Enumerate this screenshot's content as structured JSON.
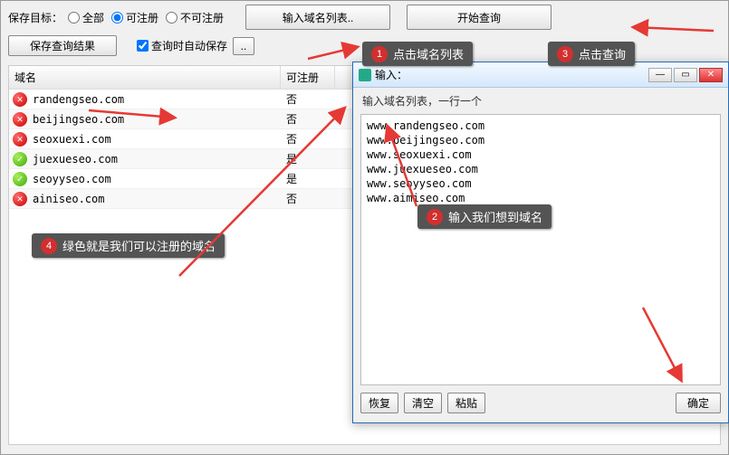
{
  "toolbar": {
    "save_target_label": "保存目标：",
    "radio_all": "全部",
    "radio_can": "可注册",
    "radio_cannot": "不可注册",
    "input_list_btn": "输入域名列表..",
    "start_query_btn": "开始查询",
    "save_results_btn": "保存查询结果",
    "auto_save_chk": "查询时自动保存",
    "dotdot_btn": ".."
  },
  "table": {
    "col_domain": "域名",
    "col_reg": "可注册",
    "rows": [
      {
        "domain": "randengseo.com",
        "reg": "否",
        "ok": false
      },
      {
        "domain": "beijingseo.com",
        "reg": "否",
        "ok": false
      },
      {
        "domain": "seoxuexi.com",
        "reg": "否",
        "ok": false
      },
      {
        "domain": "juexueseo.com",
        "reg": "是",
        "ok": true
      },
      {
        "domain": "seoyyseo.com",
        "reg": "是",
        "ok": true
      },
      {
        "domain": "ainiseo.com",
        "reg": "否",
        "ok": false
      }
    ]
  },
  "dialog": {
    "title": "输入：",
    "hint": "输入域名列表，一行一个",
    "content": "www.randengseo.com\nwww.beijingseo.com\nwww.seoxuexi.com\nwww.juexueseo.com\nwww.seoyyseo.com\nwww.aimiseo.com",
    "btn_restore": "恢复",
    "btn_clear": "清空",
    "btn_paste": "粘贴",
    "btn_ok": "确定"
  },
  "callouts": {
    "c1": "点击域名列表",
    "c2": "输入我们想到域名",
    "c3": "点击查询",
    "c4": "绿色就是我们可以注册的域名"
  }
}
